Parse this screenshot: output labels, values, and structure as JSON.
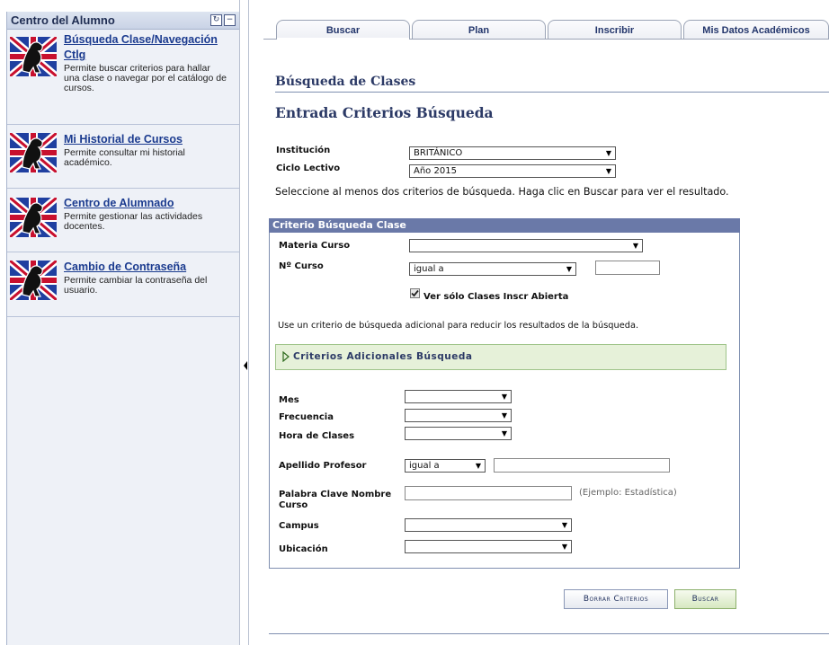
{
  "left_panel": {
    "title": "Centro del Alumno",
    "items": [
      {
        "link": "Búsqueda Clase/Navegación",
        "link2": "Ctlg",
        "desc": [
          "Permite buscar criterios para hallar",
          "una clase o navegar por el catálogo de",
          "cursos."
        ]
      },
      {
        "link": "Mi Historial de Cursos",
        "desc": [
          "Permite consultar mi historial",
          "académico."
        ]
      },
      {
        "link": "Centro de Alumnado",
        "desc": [
          "Permite gestionar las actividades",
          "docentes."
        ]
      },
      {
        "link": "Cambio de Contraseña",
        "desc": [
          "Permite cambiar la contraseña del",
          "usuario."
        ]
      }
    ]
  },
  "tabs": [
    "Buscar",
    "Plan",
    "Inscribir",
    "Mis Datos Académicos"
  ],
  "section_title": "Búsqueda de Clases",
  "subsection_title": "Entrada Criterios Búsqueda",
  "institucion": {
    "label": "Institución",
    "value": "BRITÁNICO"
  },
  "ciclo": {
    "label": "Ciclo Lectivo",
    "value": "Año 2015"
  },
  "instruction": "Seleccione al menos dos criterios de búsqueda. Haga clic en Buscar para ver el resultado.",
  "criteria": {
    "header": "Criterio Búsqueda Clase",
    "materia_label": "Materia Curso",
    "materia_value": "",
    "ncurso_label": "Nº Curso",
    "ncurso_op": "igual a",
    "ver_solo_label": "Ver sólo Clases Inscr Abierta",
    "additional_hint": "Use un criterio de búsqueda adicional para reducir los resultados de la búsqueda.",
    "additional_label": "Criterios Adicionales Búsqueda",
    "mes_label": "Mes",
    "frecuencia_label": "Frecuencia",
    "hora_label": "Hora de Clases",
    "apellido_label": "Apellido Profesor",
    "apellido_op": "igual a",
    "palabra_label_1": "Palabra Clave Nombre",
    "palabra_label_2": "Curso",
    "palabra_example": "(Ejemplo: Estadística)",
    "campus_label": "Campus",
    "ubicacion_label": "Ubicación"
  },
  "buttons": {
    "clear": "Borrar Criterios",
    "search": "Buscar"
  },
  "colors": {
    "header_bar": "#6a79a8",
    "additional_bg": "#e6f1d9",
    "link": "#1b3b8f"
  }
}
